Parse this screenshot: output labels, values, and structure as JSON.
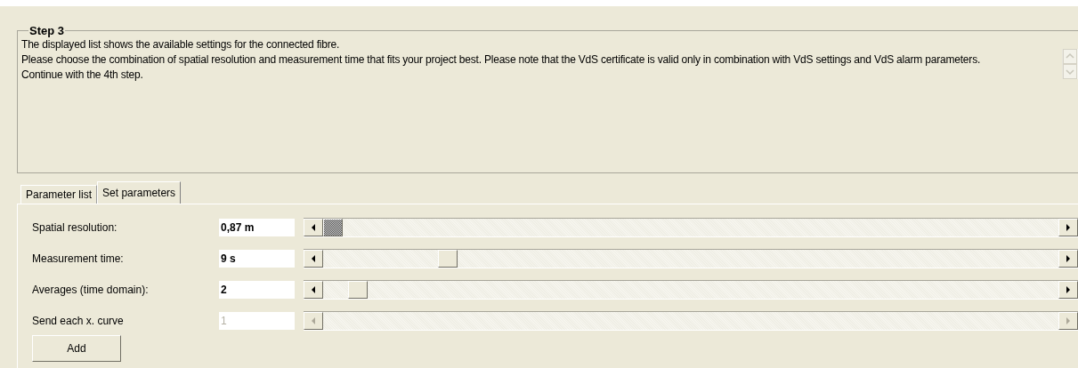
{
  "step": {
    "title": "Step 3",
    "lines": [
      "The displayed list shows the available settings for the connected fibre.",
      "Please choose the combination of spatial resolution and measurement time that fits your project best. Please note that the VdS certificate is valid only in combination with VdS settings and VdS alarm parameters.",
      "Continue with the 4th step."
    ]
  },
  "tabs": [
    {
      "label": "Parameter list",
      "selected": false
    },
    {
      "label": "Set parameters",
      "selected": true
    }
  ],
  "parameters": [
    {
      "label": "Spatial resolution:",
      "value": "0,87 m",
      "level": 0,
      "focused": true,
      "disabled": false
    },
    {
      "label": "Measurement time:",
      "value": "9 s",
      "level": 0.16,
      "focused": false,
      "disabled": false
    },
    {
      "label": "Averages (time domain):",
      "value": "2",
      "level": 0.035,
      "focused": false,
      "disabled": false
    },
    {
      "label": "Send each x. curve",
      "value": "1",
      "disabled": true
    }
  ],
  "buttons": [
    "Add"
  ]
}
